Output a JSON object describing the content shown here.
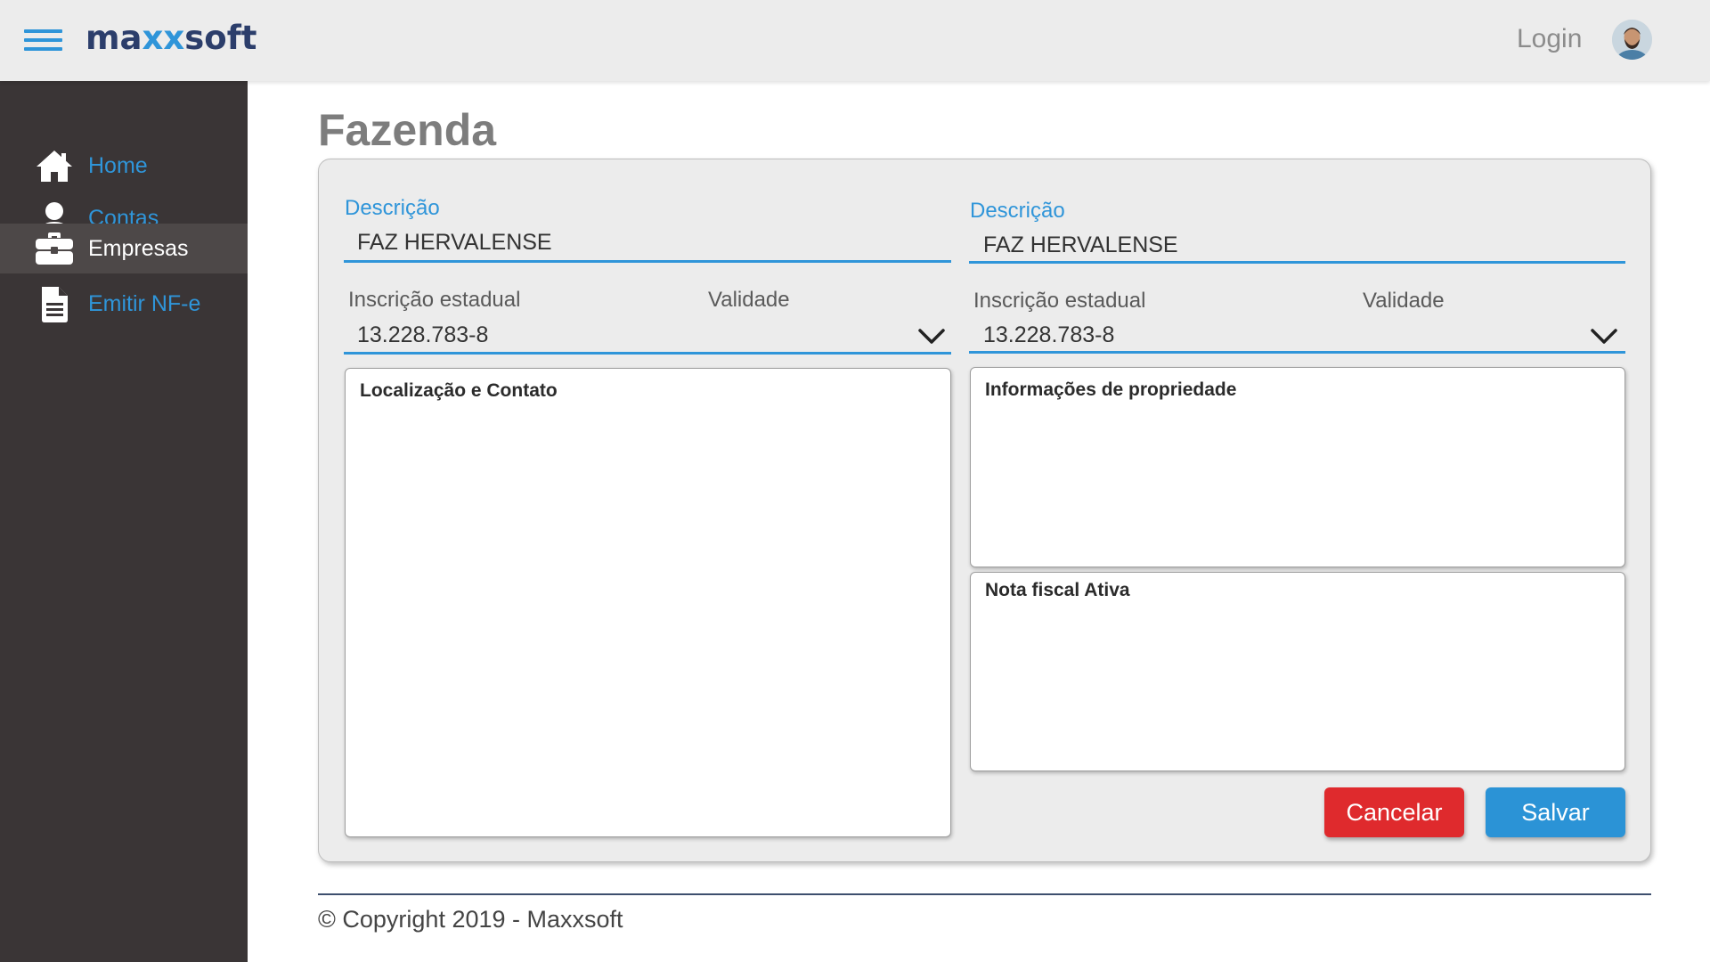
{
  "header": {
    "logo_part1": "ma",
    "logo_part2": "xx",
    "logo_part3": "soft",
    "login_label": "Login",
    "avatar_icon": "user-avatar"
  },
  "sidebar": {
    "items": [
      {
        "label": "Home",
        "icon": "home-icon",
        "active": false
      },
      {
        "label": "Contas",
        "icon": "user-icon",
        "active": false
      },
      {
        "label": "Empresas",
        "icon": "briefcase-icon",
        "active": true
      },
      {
        "label": "Emitir NF-e",
        "icon": "document-icon",
        "active": false
      }
    ]
  },
  "main": {
    "title": "Fazenda",
    "left": {
      "descricao_label": "Descrição",
      "descricao_value": "FAZ HERVALENSE",
      "inscricao_label": "Inscrição estadual",
      "validade_label": "Validade",
      "inscricao_value": "13.228.783-8",
      "panel_title": "Localização e Contato"
    },
    "right": {
      "descricao_label": "Descrição",
      "descricao_value": "FAZ HERVALENSE",
      "inscricao_label": "Inscrição estadual",
      "validade_label": "Validade",
      "inscricao_value": "13.228.783-8",
      "panel1_title": "Informações de propriedade",
      "panel2_title": "Nota fiscal Ativa"
    },
    "buttons": {
      "cancel_label": "Cancelar",
      "save_label": "Salvar"
    }
  },
  "footer": {
    "copyright": "© Copyright 2019 - Maxxsoft"
  },
  "colors": {
    "accent": "#2f95d9",
    "sidebar_bg": "#3a3536",
    "cancel": "#df2a2d",
    "save": "#2b93d6",
    "logo_dark": "#2c3e6b"
  }
}
